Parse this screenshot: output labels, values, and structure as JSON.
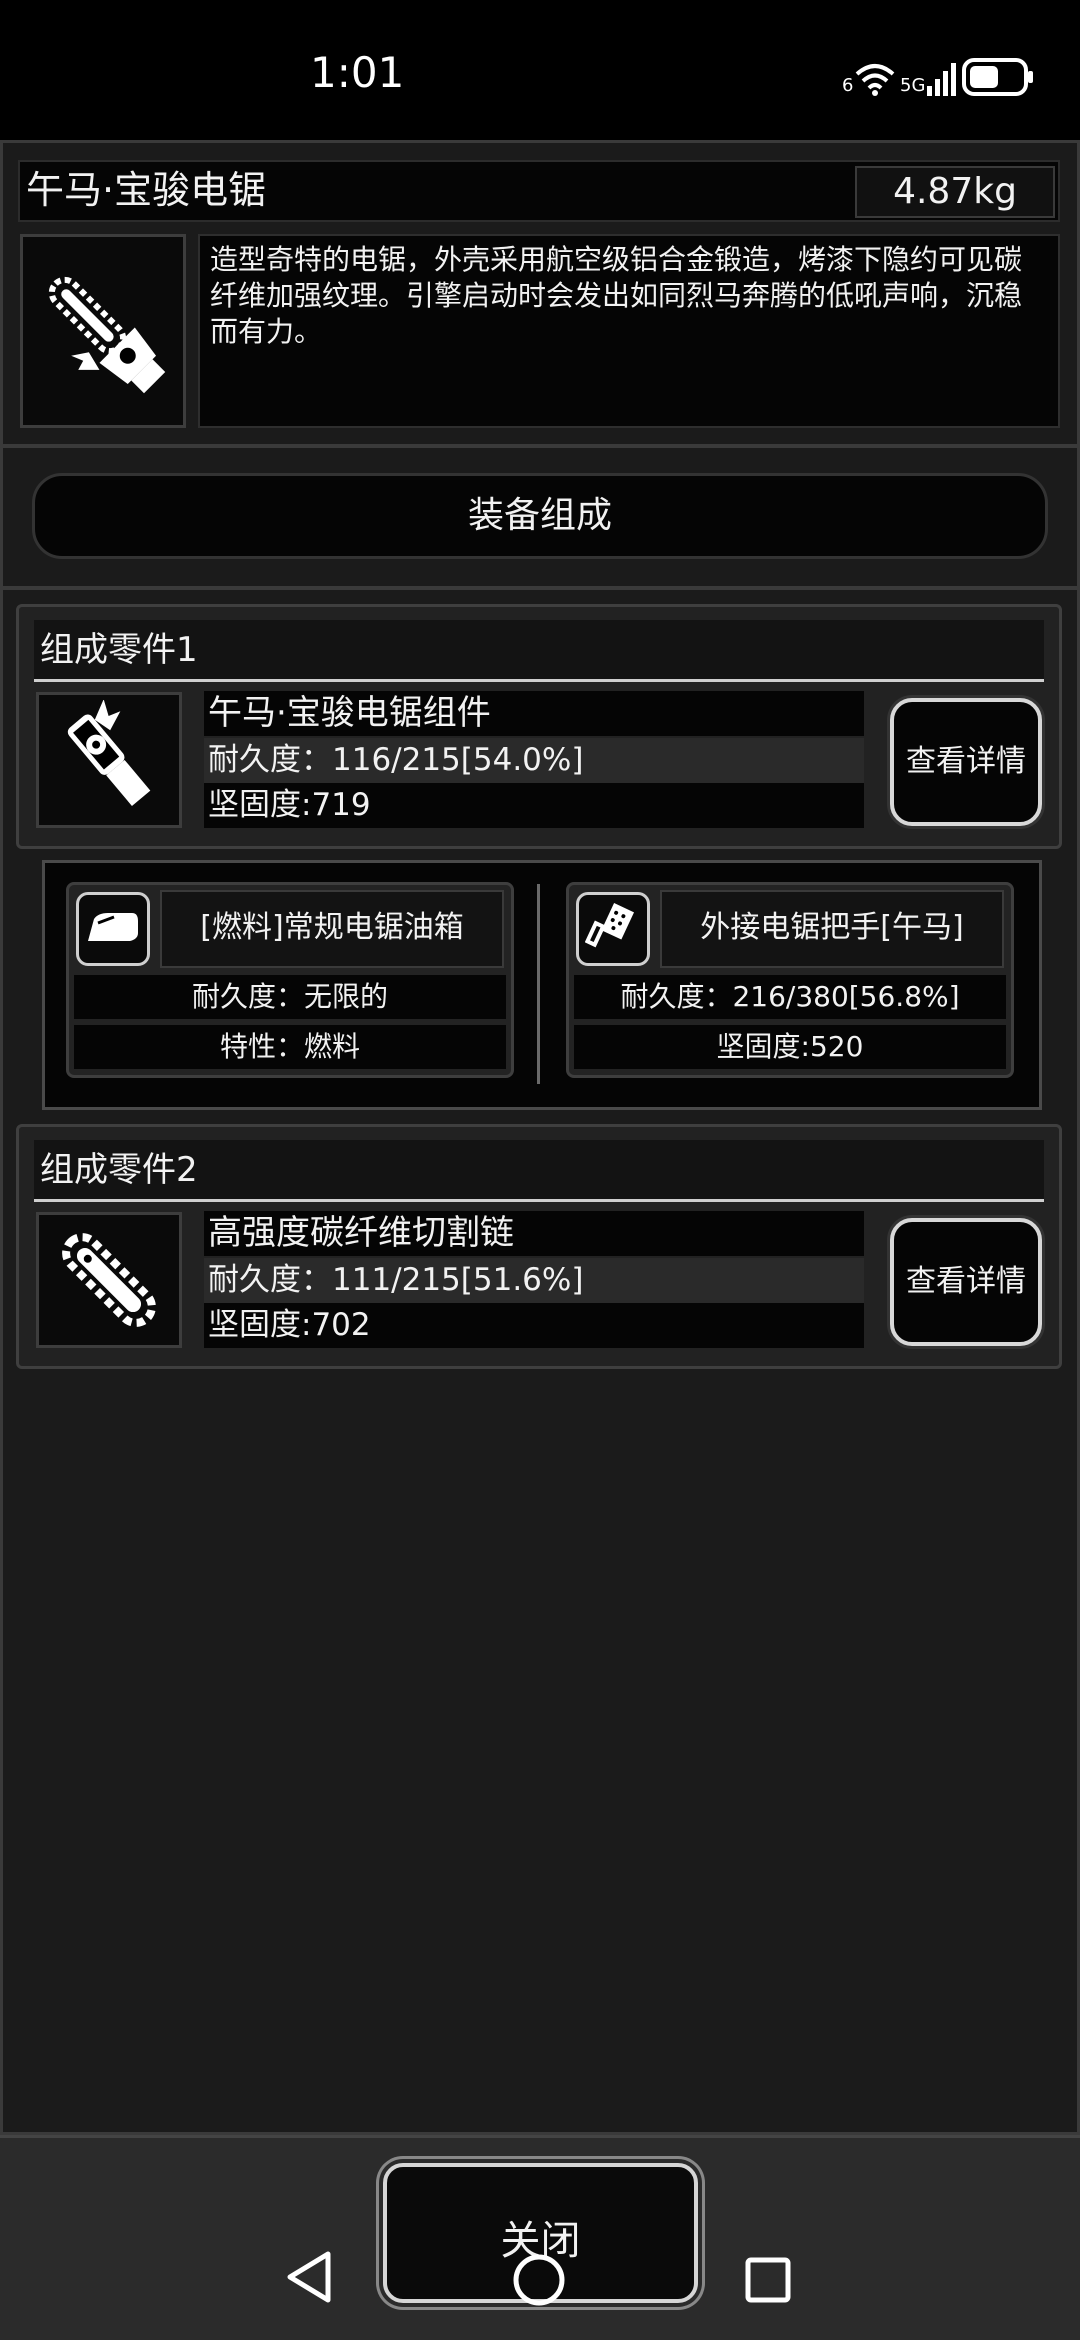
{
  "status_bar": {
    "time": "1:01",
    "signal_a": "6",
    "signal_b": "5G"
  },
  "item": {
    "name": "午马·宝骏电锯",
    "weight": "4.87kg",
    "description": "造型奇特的电锯，外壳采用航空级铝合金锻造，烤漆下隐约可见碳纤维加强纹理。引擎启动时会发出如同烈马奔腾的低吼声响，沉稳而有力。"
  },
  "tab": {
    "label": "装备组成"
  },
  "component1": {
    "header": "组成零件1",
    "name": "午马·宝骏电锯组件",
    "durability": "耐久度：116/215[54.0%]",
    "hardness": "坚固度:719",
    "detail_button": "查看详情",
    "subparts": [
      {
        "name": "[燃料]常规电锯油箱",
        "line1": "耐久度：无限的",
        "line2": "特性：燃料"
      },
      {
        "name": "外接电锯把手[午马]",
        "line1": "耐久度：216/380[56.8%]",
        "line2": "坚固度:520"
      }
    ]
  },
  "component2": {
    "header": "组成零件2",
    "name": "高强度碳纤维切割链",
    "durability": "耐久度：111/215[51.6%]",
    "hardness": "坚固度:702",
    "detail_button": "查看详情"
  },
  "footer": {
    "close_label": "关闭"
  }
}
